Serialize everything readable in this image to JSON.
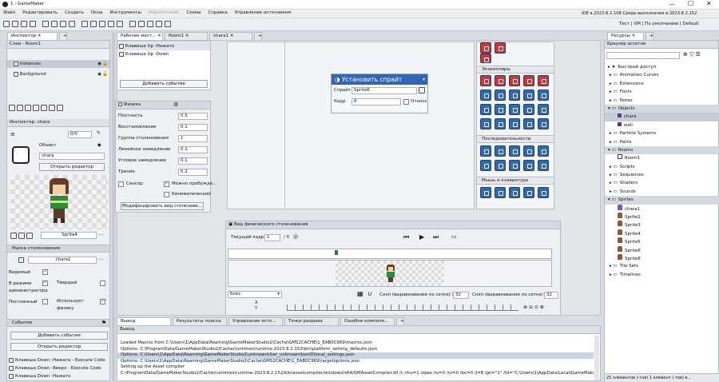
{
  "window": {
    "title": "1 - GameMaker",
    "icon": "gamemaker-logo-icon"
  },
  "menu": [
    "Файл",
    "Редактировать",
    "Создать",
    "Окна",
    "Инструменты",
    "Маркетплейс",
    "Схема",
    "Справка",
    "Управление источником"
  ],
  "ide_info": "IDE в.2023.8.2.108  Среда выполнения в.2023.8.2.152",
  "targets": "Тест | VM | По умолчанию | Default",
  "inspector": {
    "tab": "Инспектор",
    "layers_title": "Слои - Room1",
    "layers": [
      "Instances",
      "Background"
    ],
    "sub_title": "Инспектор: chara",
    "zoom": "0/0",
    "object_label": "Объект",
    "object_name": "chara",
    "open_editor": "Открыть редактор",
    "sprite_name": "Sprite4",
    "mask_title": "Маска столкновения",
    "mask_value": "chara1",
    "visible": "Видимый",
    "persistent": "Постоянный",
    "solid": "Твердый",
    "uses_physics": "Использует физику",
    "in_admin": "В режиме администратора",
    "events_title": "События",
    "add_event": "Добавить событие",
    "open_editor2": "Открыть редактор",
    "events": [
      "Клавиша Down -Нажата - Execute Code",
      "Клавиша Down -Вверх - Execute Code",
      "Клавиша Down -Нажато"
    ]
  },
  "room_tabs": [
    "Рабочее мест...",
    "Room1",
    "chara1"
  ],
  "event_list": {
    "items": [
      "Клавиша Up -Нажато",
      "Клавиша Up -Down"
    ],
    "add": "Добавить событие"
  },
  "physics": {
    "title": "Физика",
    "fields": [
      {
        "label": "Плотность",
        "value": "0.5"
      },
      {
        "label": "Восстановление",
        "value": "0.1"
      },
      {
        "label": "Группа столкновения",
        "value": "1"
      },
      {
        "label": "Линейное замедление",
        "value": "0.1"
      },
      {
        "label": "Угловое замедление",
        "value": "0.1"
      },
      {
        "label": "Трение",
        "value": "0.2"
      }
    ],
    "sensor": "Сенсор",
    "sleep": "Можно пробужде...",
    "kinematic": "Кинематический",
    "modify_btn": "Модифицировать вид столкнове..."
  },
  "action": {
    "title": "Установить спрайт",
    "sprite_label": "Спрайт",
    "sprite_value": "Sprite6",
    "frame_label": "Кадр",
    "frame_value": "0",
    "relative": "Относит"
  },
  "toolbox": {
    "section1": "Экземпляры",
    "section2": "Последовательности",
    "section3": "Мышь и клавиатура"
  },
  "collision_view": {
    "title": "Вид физического столкновения",
    "frame_label": "Текущий кадр:",
    "frame_value": "1",
    "frame_total": "/ 0",
    "shape": "Бокс",
    "snap_x_label": "Снэп (выравнивание по сетке) X",
    "snap_x": "32",
    "snap_y_label": "Снэп (выравнивание по сетке) Y",
    "snap_y": "32",
    "x_label": "X",
    "y_label": "Y"
  },
  "output": {
    "tabs": [
      "Вывод",
      "Результаты поиска",
      "Управление исто...",
      "Точки разрыва",
      "Ошибки компиля..."
    ],
    "title": "Вывод",
    "lines": [
      "Loaded Macros from C:\\Users\\1\\AppData\\Roaming\\GameMakerStudio2\\Cache\\GMS2CACHE\\1_EAB0C969\\macros.json",
      "Options: C:\\ProgramData/GameMakerStudio2/Cache/runtimes\\runtime-2023.8.2.152\\bin\\platform_setting_defaults.json",
      "Options: C:\\Users\\1\\AppData\\Roaming\\GameMakerStudio2\\unknownUser_unknownUserID\\local_settings.json",
      "Options: C:\\Users\\1\\AppData\\Roaming\\GameMakerStudio2\\Cache\\GMS2CACHE\\1_EAB0C969\\targetoptions.json",
      "Setting up the Asset compiler",
      "C:\\ProgramData/GameMakerStudio2/Cache/runtimes\\runtime-2023.8.2.152/bin/assetcompiler/windows/x64/GMAssetCompiler.dll /c /mv=1 /zpex /iv=0 /rv=0 /bv=0 /j=8 /gn=\"1\" /td=\"C:\\Users\\1\\AppData\\Local\\GameMakerStudio"
    ]
  },
  "resources": {
    "tab": "Ресурсы",
    "browser": "Браузер ассетов",
    "items": [
      {
        "name": "Быстрый доступ",
        "kind": "header"
      },
      {
        "name": "Animation Curves",
        "kind": "folder"
      },
      {
        "name": "Extensions",
        "kind": "folder"
      },
      {
        "name": "Fonts",
        "kind": "folder"
      },
      {
        "name": "Notes",
        "kind": "folder"
      },
      {
        "name": "Objects",
        "kind": "group"
      },
      {
        "name": "chara",
        "kind": "object",
        "sel": true
      },
      {
        "name": "wall",
        "kind": "object"
      },
      {
        "name": "Particle Systems",
        "kind": "folder"
      },
      {
        "name": "Paths",
        "kind": "folder"
      },
      {
        "name": "Rooms",
        "kind": "group"
      },
      {
        "name": "Room1",
        "kind": "room"
      },
      {
        "name": "Scripts",
        "kind": "folder"
      },
      {
        "name": "Sequences",
        "kind": "folder"
      },
      {
        "name": "Shaders",
        "kind": "folder"
      },
      {
        "name": "Sounds",
        "kind": "folder"
      },
      {
        "name": "Sprites",
        "kind": "group"
      },
      {
        "name": "chara1",
        "kind": "sprite"
      },
      {
        "name": "Sprite2",
        "kind": "sprite"
      },
      {
        "name": "Sprite3",
        "kind": "sprite"
      },
      {
        "name": "Sprite4",
        "kind": "sprite"
      },
      {
        "name": "Sprite5",
        "kind": "sprite"
      },
      {
        "name": "Sprite6",
        "kind": "sprite"
      },
      {
        "name": "Sprite8",
        "kind": "sprite"
      },
      {
        "name": "Tile Sets",
        "kind": "folder"
      },
      {
        "name": "Timelines",
        "kind": "folder"
      }
    ],
    "footer": "25 элементов (-тов)  1 элемент (-тов) в..."
  }
}
